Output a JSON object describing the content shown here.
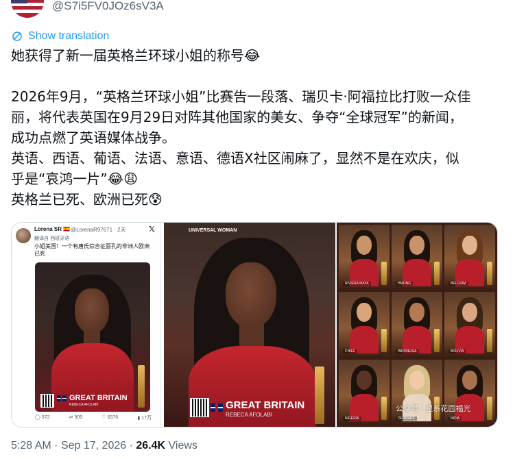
{
  "post": {
    "handle": "@S7i5FV0JOz6sV3A",
    "show_translation": "Show translation",
    "text_lines": [
      "她获得了新一届英格兰环球小姐的称号😂",
      "",
      "2026年9月，“英格兰环球小姐”比赛告一段落、瑞贝卡·阿福拉比打败一众佳",
      "丽，将代表英国在9月29日对阵其他国家的美女、争夺“全球冠军”的新闻，",
      "成功点燃了英语媒体战争。",
      "英语、西语、葡语、法语、意语、德语X社区闹麻了，显然不是在欢庆，似",
      "乎是“哀鸿一片”😂😩",
      "英格兰已死、欧洲已死😰"
    ],
    "time": "5:28 AM",
    "date": "Sep 17, 2026",
    "views_count": "26.4K",
    "views_label": "Views"
  },
  "media": {
    "screenshot": {
      "name": "Lorena SR 🇪🇸",
      "handle": "@LorenaR97671 · 2天",
      "translated_from": "翻译自 西班牙语",
      "text": "小姐美国！一个有唐氏综合征面孔的非洲人欧洲已死",
      "caption_title": "GREAT BRITAIN",
      "caption_sub": "REBECA AFOLABI",
      "stats": [
        "572",
        "909",
        "6376",
        "17万"
      ]
    },
    "portrait": {
      "brand": "UNIVERSAL WOMAN",
      "caption_title": "GREAT BRITAIN",
      "caption_sub": "REBECA AFOLABI"
    },
    "grid_labels": [
      "RIVIERA MAYA",
      "HMONG",
      "BELGIUM",
      "CHILE",
      "INDONESIA",
      "BOLIVIA",
      "NIGERIA",
      "DENMARK",
      "INDIA"
    ],
    "watermark": "公众号 · 星系花园福光"
  },
  "icons": {
    "translate": "translate-icon",
    "close_x": "x-logo-icon"
  },
  "colors": {
    "link": "#1d9bf0",
    "muted": "#536471",
    "text": "#0f1419",
    "border": "#cfd9de"
  }
}
